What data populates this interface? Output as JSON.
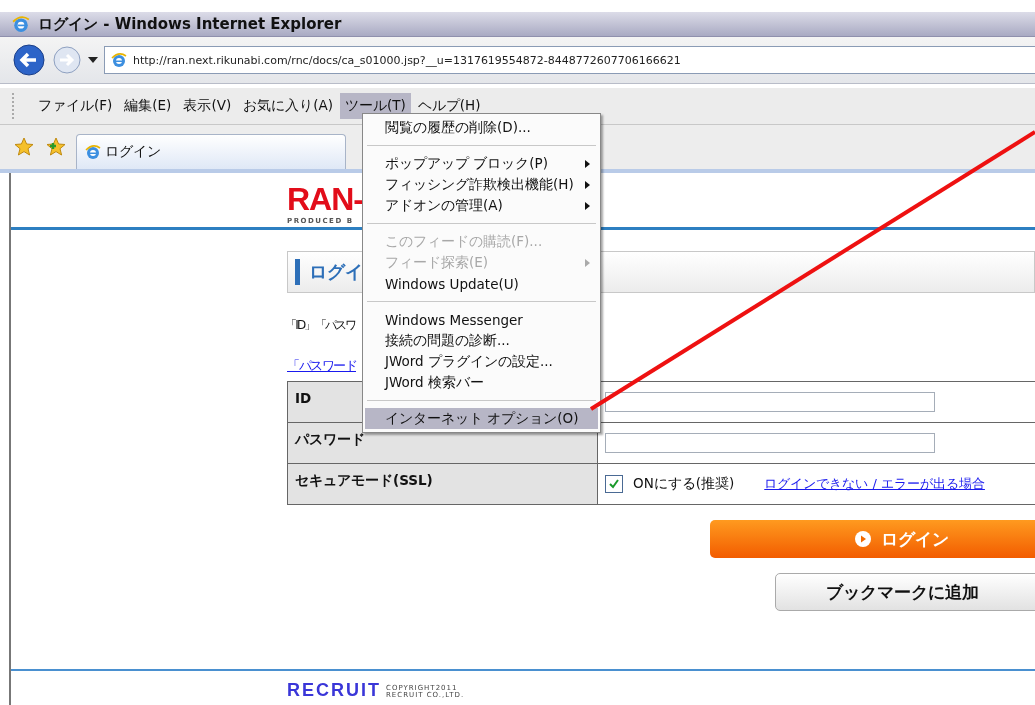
{
  "window": {
    "title": "ログイン - Windows Internet Explorer"
  },
  "address_bar": {
    "url": "http://ran.next.rikunabi.com/rnc/docs/ca_s01000.jsp?__u=1317619554872-8448772607706166621"
  },
  "menu_bar": [
    {
      "label": "ファイル(F)",
      "selected": false
    },
    {
      "label": "編集(E)",
      "selected": false
    },
    {
      "label": "表示(V)",
      "selected": false
    },
    {
      "label": "お気に入り(A)",
      "selected": false
    },
    {
      "label": "ツール(T)",
      "selected": true
    },
    {
      "label": "ヘルプ(H)",
      "selected": false
    }
  ],
  "tab": {
    "title": "ログイン"
  },
  "tools_menu": {
    "items": [
      {
        "kind": "item",
        "label": "閲覧の履歴の削除(D)...",
        "disabled": false,
        "submenu": false,
        "selected": false
      },
      {
        "kind": "separator"
      },
      {
        "kind": "item",
        "label": "ポップアップ ブロック(P)",
        "disabled": false,
        "submenu": true,
        "selected": false
      },
      {
        "kind": "item",
        "label": "フィッシング詐欺検出機能(H)",
        "disabled": false,
        "submenu": true,
        "selected": false
      },
      {
        "kind": "item",
        "label": "アドオンの管理(A)",
        "disabled": false,
        "submenu": true,
        "selected": false
      },
      {
        "kind": "separator"
      },
      {
        "kind": "item",
        "label": "このフィードの購読(F)...",
        "disabled": true,
        "submenu": false,
        "selected": false
      },
      {
        "kind": "item",
        "label": "フィード探索(E)",
        "disabled": true,
        "submenu": true,
        "selected": false
      },
      {
        "kind": "item",
        "label": "Windows Update(U)",
        "disabled": false,
        "submenu": false,
        "selected": false
      },
      {
        "kind": "separator"
      },
      {
        "kind": "item",
        "label": "Windows Messenger",
        "disabled": false,
        "submenu": false,
        "selected": false
      },
      {
        "kind": "item",
        "label": "接続の問題の診断...",
        "disabled": false,
        "submenu": false,
        "selected": false
      },
      {
        "kind": "item",
        "label": "JWord プラグインの設定...",
        "disabled": false,
        "submenu": false,
        "selected": false
      },
      {
        "kind": "item",
        "label": "JWord 検索バー",
        "disabled": false,
        "submenu": false,
        "selected": false
      },
      {
        "kind": "separator"
      },
      {
        "kind": "item",
        "label": "インターネット オプション(O)",
        "disabled": false,
        "submenu": false,
        "selected": true
      }
    ]
  },
  "page": {
    "logo": {
      "text": "RAN-",
      "tagline": "PRODUCED B"
    },
    "heading": "ログイ",
    "intro": "「ID」「パスワ",
    "link": "「パスワード",
    "form": {
      "rows": [
        {
          "kind": "input",
          "label": "ID"
        },
        {
          "kind": "input",
          "label": "パスワード"
        },
        {
          "kind": "checkbox",
          "label": "セキュアモード(SSL)",
          "option": "ONにする(推奨)",
          "checked": true,
          "link": "ログインできない / エラーが出る場合"
        }
      ]
    },
    "login_button": "ログイン",
    "bookmark_button": "ブックマークに追加",
    "footer": {
      "logo": "RECRUIT",
      "copyright": [
        "COPYRIGHT2011",
        "RECRUIT CO.,LTD."
      ]
    }
  }
}
